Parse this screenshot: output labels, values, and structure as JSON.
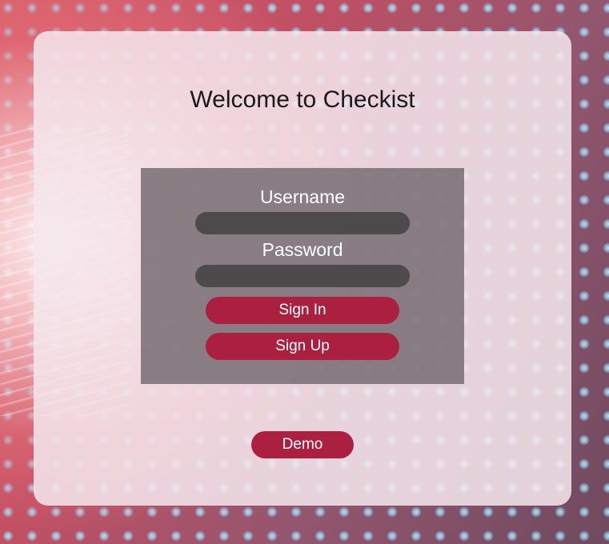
{
  "app": {
    "title": "Welcome to Checkist"
  },
  "login": {
    "username_label": "Username",
    "username_value": "",
    "password_label": "Password",
    "password_value": "",
    "signin_label": "Sign In",
    "signup_label": "Sign Up"
  },
  "demo": {
    "label": "Demo"
  },
  "colors": {
    "button": "#ab1f41",
    "input": "#4e4a4b",
    "panel": "#786e73",
    "card": "#f5e8ee"
  }
}
